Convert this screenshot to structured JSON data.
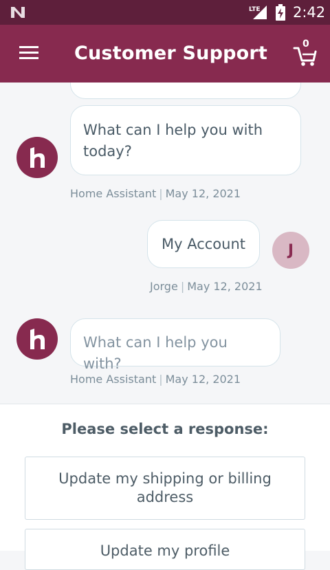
{
  "status_bar": {
    "network_label": "LTE",
    "time": "2:42"
  },
  "header": {
    "title": "Customer Support",
    "cart_count": "0"
  },
  "messages": [
    {
      "sender": "Home Assistant",
      "text": "What can I help you with today?",
      "date": "May 12, 2021"
    },
    {
      "sender": "Jorge",
      "text": "My Account",
      "date": "May 12, 2021",
      "avatar_initial": "J"
    },
    {
      "sender": "Home Assistant",
      "text": "What can I help you with?",
      "date": "May 12, 2021"
    }
  ],
  "response_panel": {
    "prompt": "Please select a response:",
    "options": [
      "Update my shipping or billing address",
      "Update my profile"
    ]
  },
  "colors": {
    "status_bar": "#5e1f3b",
    "app_bar": "#872a4f",
    "avatar_user": "#d9b8c4"
  },
  "icons": {
    "menu": "hamburger-icon",
    "cart": "cart-icon",
    "assistant_avatar": "home-assistant-logo"
  }
}
